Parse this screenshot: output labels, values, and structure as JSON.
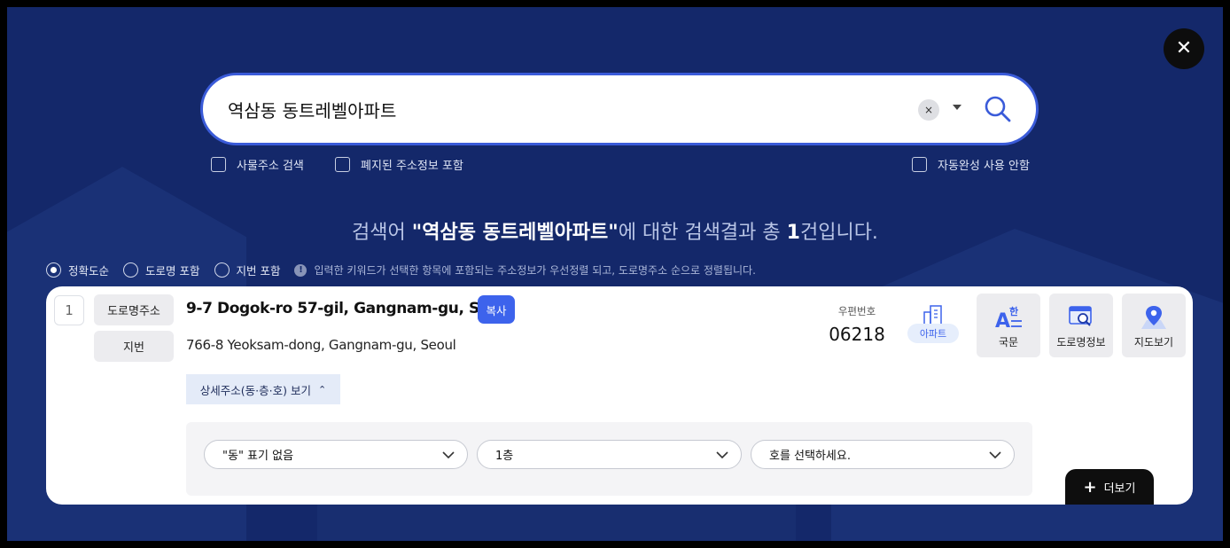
{
  "search": {
    "value": "역삼동 동트레벨아파트",
    "clear_symbol": "×"
  },
  "close": {
    "symbol": "✕"
  },
  "options": {
    "building_addr": "사물주소 검색",
    "abolished": "폐지된 주소정보 포함",
    "autocomplete_off": "자동완성 사용 안함"
  },
  "result_title": {
    "prefix": "검색어 ",
    "keyword": "\"역삼동 동트레벨아파트\"",
    "middle": "에 대한 검색결과 총 ",
    "count": "1",
    "suffix": "건입니다."
  },
  "sort": {
    "accuracy": "정확도순",
    "road": "도로명 포함",
    "jibun": "지번 포함",
    "info_symbol": "!",
    "note": "입력한 키워드가 선택한 항목에 포함되는 주소정보가 우선정렬 되고, 도로명주소 순으로 정렬됩니다."
  },
  "result": {
    "index": "1",
    "road_label": "도로명주소",
    "jibun_label": "지번",
    "road_address": "9-7 Dogok-ro 57-gil, Gangnam-gu, Seoul",
    "copy_label": "복사",
    "jibun_address": "766-8 Yeoksam-dong, Gangnam-gu, Seoul",
    "detail_toggle": "상세주소(동·층·호) 보기",
    "detail_chevron": "⌃",
    "zip_label": "우편번호",
    "zip_code": "06218",
    "building_type": "아파트",
    "actions": {
      "korean": "국문",
      "road_info": "도로명정보",
      "map": "지도보기"
    },
    "selects": {
      "dong": "\"동\" 표기 없음",
      "floor": "1층",
      "ho": "호를 선택하세요."
    }
  },
  "more": {
    "plus": "+",
    "label": "더보기"
  },
  "colors": {
    "background": "#14286a",
    "accent": "#3d63ec",
    "search_border": "#3a5bd9"
  }
}
